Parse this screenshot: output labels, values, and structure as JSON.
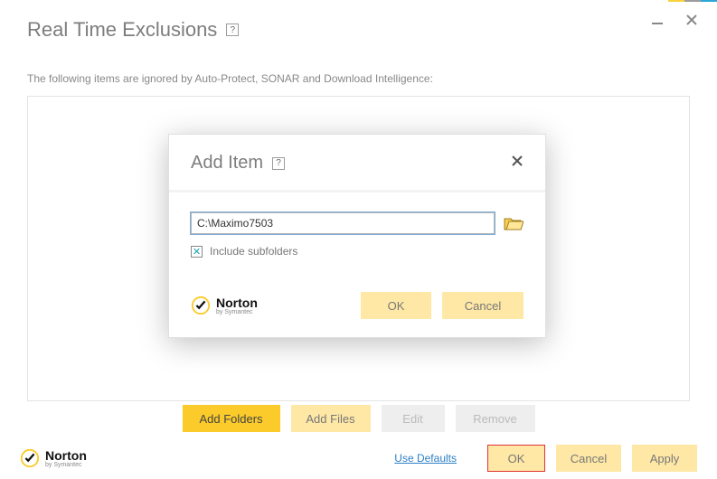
{
  "header": {
    "title": "Real Time Exclusions"
  },
  "subtitle": "The following items are ignored by Auto-Protect, SONAR and Download Intelligence:",
  "main_buttons": {
    "add_folders": "Add Folders",
    "add_files": "Add Files",
    "edit": "Edit",
    "remove": "Remove"
  },
  "footer": {
    "use_defaults": "Use Defaults",
    "ok": "OK",
    "cancel": "Cancel",
    "apply": "Apply"
  },
  "brand": {
    "name": "Norton",
    "sub": "by Symantec"
  },
  "modal": {
    "title": "Add Item",
    "path": "C:\\Maximo7503",
    "include_label": "Include subfolders",
    "ok": "OK",
    "cancel": "Cancel"
  }
}
